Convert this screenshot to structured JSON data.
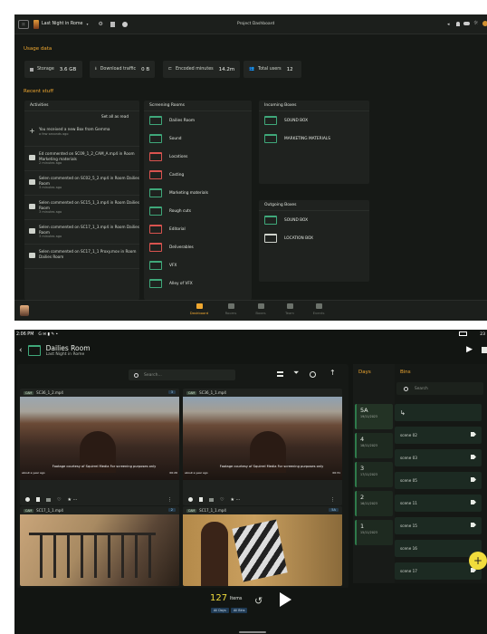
{
  "dashboard": {
    "app_title": "Last Night in Rome",
    "window_title": "Project Dashboard",
    "usage_heading": "Usage data",
    "stats": [
      {
        "label": "Storage",
        "value": "3.6 GB"
      },
      {
        "label": "Download traffic",
        "value": "0 B"
      },
      {
        "label": "Encoded minutes",
        "value": "14.2m"
      },
      {
        "label": "Total users",
        "value": "12"
      }
    ],
    "recent_heading": "Recent stuff",
    "activities": {
      "title": "Activities",
      "mark_read": "Set all as read",
      "items": [
        {
          "text": "You received a new Box from Gemma",
          "time": "a few seconds ago"
        },
        {
          "text": "Ed commented on SC09_1_2_CAM_A.mp4 in Room Marketing materials",
          "time": "2 minutes ago"
        },
        {
          "text": "Selen commented on SC02_5_2.mp4 in Room Dailies Room",
          "time": "3 minutes ago"
        },
        {
          "text": "Selen commented on SC15_1_3.mp4 in Room Dailies Room",
          "time": "3 minutes ago"
        },
        {
          "text": "Selen commented on SC17_1_3.mp4 in Room Dailies Room",
          "time": "3 minutes ago"
        },
        {
          "text": "Selen commented on SC17_1_1 Proxy.mov in Room Dailies Room",
          "time": ""
        }
      ]
    },
    "screening_rooms": {
      "title": "Screening Rooms",
      "items": [
        "Dailies Room",
        "Sound",
        "Locations",
        "Casting",
        "Marketing materials",
        "Rough cuts",
        "Editorial",
        "Deliverables",
        "VFX",
        "Alley of VFX"
      ]
    },
    "incoming_boxes": {
      "title": "Incoming Boxes",
      "items": [
        "SOUND BOX",
        "MARKETING MATERIALS"
      ]
    },
    "outgoing_boxes": {
      "title": "Outgoing Boxes",
      "items": [
        "SOUND BOX",
        "LOCATION BOX"
      ]
    },
    "nav": [
      "Dashboard",
      "Rooms",
      "Boxes",
      "Team",
      "Events"
    ]
  },
  "room": {
    "status_time": "2:06 PM",
    "status_right": "23",
    "title": "Dailies Room",
    "subtitle": "Last Night in Rome",
    "search_placeholder": "Search...",
    "clips": [
      {
        "tag": "CAM",
        "name": "SC36_1_2.mp4",
        "count": "3",
        "caption": "Footage courtesy of Squirrel Media For screening purposes only",
        "meta_left": "about a year ago",
        "meta_right": "00:26"
      },
      {
        "tag": "CAM",
        "name": "SC36_1_1.mp4",
        "count": "",
        "caption": "Footage courtesy of Squirrel Media For screening purposes only",
        "meta_left": "about a year ago",
        "meta_right": "00:31"
      },
      {
        "tag": "CAM",
        "name": "SC17_1_1.mp4",
        "count": "2"
      },
      {
        "tag": "CAM",
        "name": "SC17_1_1.mp4",
        "count": "5A"
      }
    ],
    "days_title": "Days",
    "days": [
      {
        "day": "5A",
        "date": "19/11/2023"
      },
      {
        "day": "4",
        "date": "18/11/2023"
      },
      {
        "day": "3",
        "date": "17/11/2023"
      },
      {
        "day": "2",
        "date": "16/11/2023"
      },
      {
        "day": "1",
        "date": "15/11/2023"
      }
    ],
    "bins_title": "Bins",
    "bins_search_placeholder": "Search",
    "bins": [
      "scene 02",
      "scene 03",
      "scene 05",
      "scene 11",
      "scene 15",
      "scene 16",
      "scene 17"
    ],
    "items_count": "127",
    "items_label": "Items",
    "chip_days": "All Days",
    "chip_bins": "All Bins",
    "colors": {
      "accent_green": "#3fa87a",
      "accent_yellow": "#f0a830",
      "fab": "#f1dc3c"
    }
  }
}
